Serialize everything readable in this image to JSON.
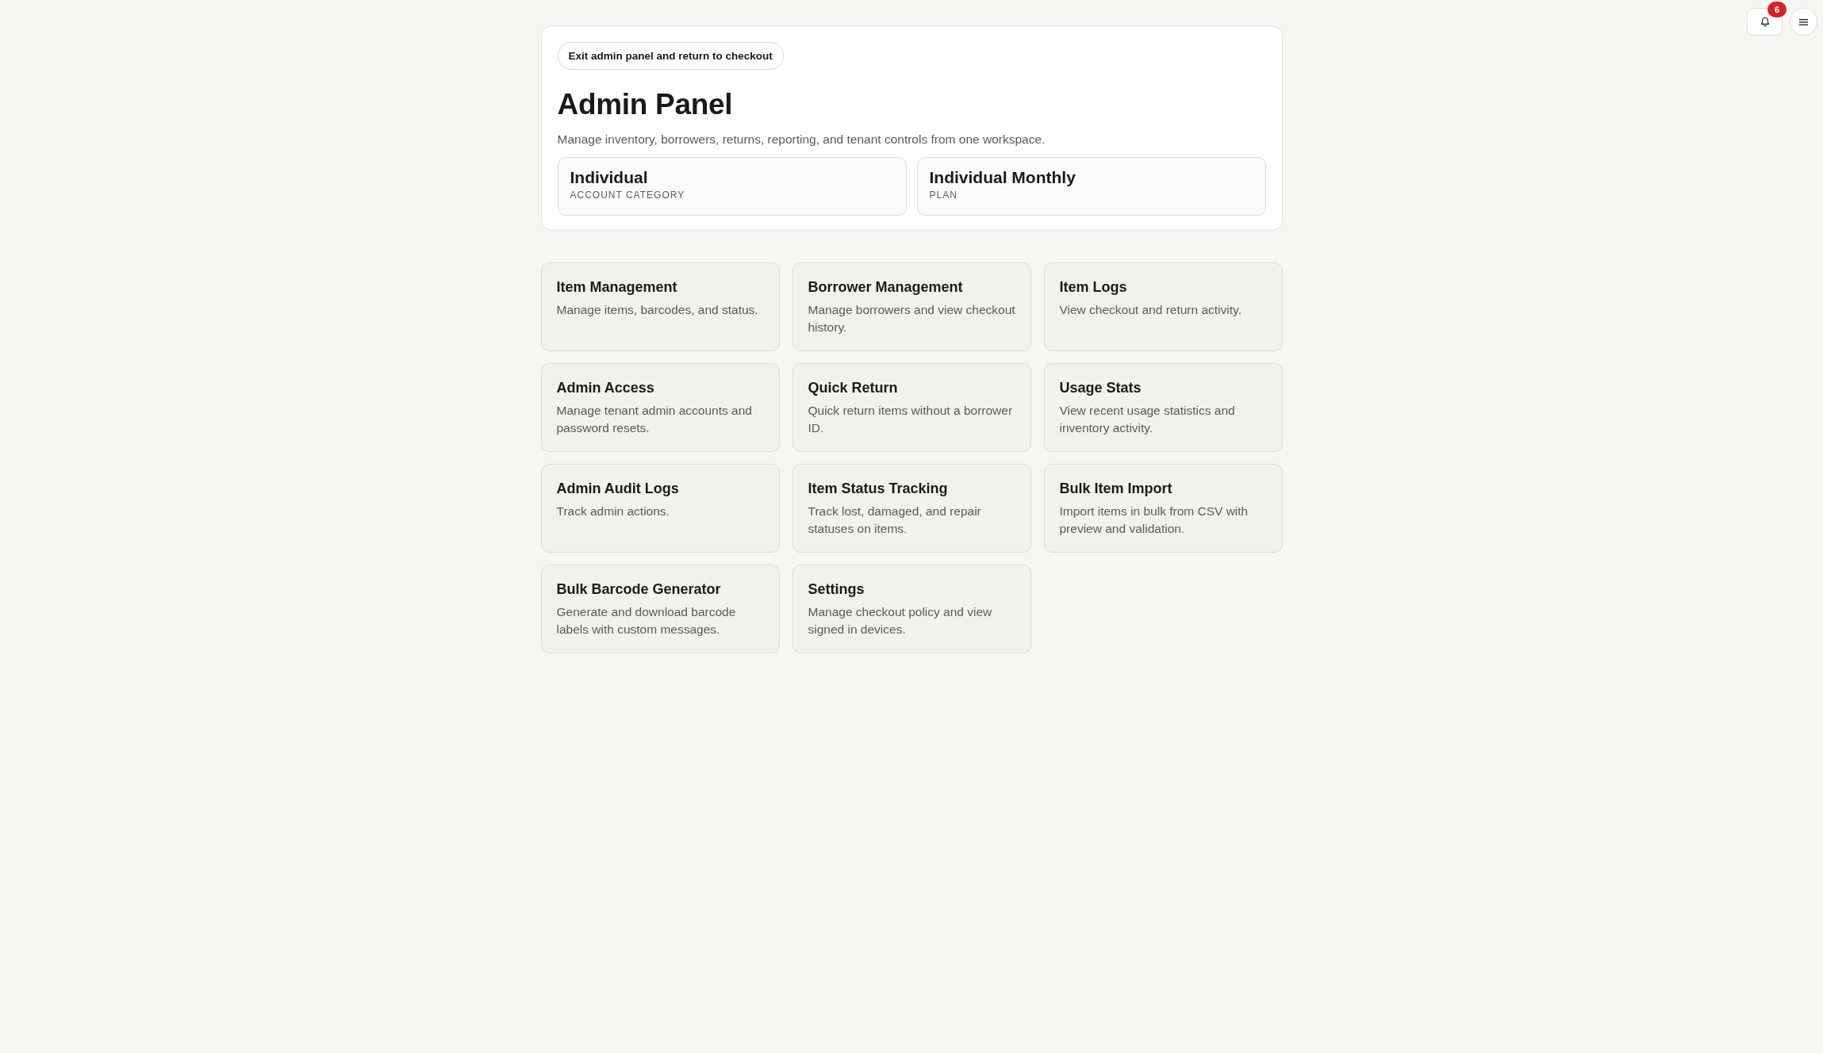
{
  "top_bar": {
    "notification_count": "6"
  },
  "header": {
    "exit_button": "Exit admin panel and return to checkout",
    "title": "Admin Panel",
    "subtitle": "Manage inventory, borrowers, returns, reporting, and tenant controls from one workspace.",
    "info": [
      {
        "value": "Individual",
        "label": "ACCOUNT CATEGORY"
      },
      {
        "value": "Individual Monthly",
        "label": "PLAN"
      }
    ]
  },
  "tools": [
    {
      "title": "Item Management",
      "description": "Manage items, barcodes, and status."
    },
    {
      "title": "Borrower Management",
      "description": "Manage borrowers and view checkout history."
    },
    {
      "title": "Item Logs",
      "description": "View checkout and return activity."
    },
    {
      "title": "Admin Access",
      "description": "Manage tenant admin accounts and password resets."
    },
    {
      "title": "Quick Return",
      "description": "Quick return items without a borrower ID."
    },
    {
      "title": "Usage Stats",
      "description": "View recent usage statistics and inventory activity."
    },
    {
      "title": "Admin Audit Logs",
      "description": "Track admin actions."
    },
    {
      "title": "Item Status Tracking",
      "description": "Track lost, damaged, and repair statuses on items."
    },
    {
      "title": "Bulk Item Import",
      "description": "Import items in bulk from CSV with preview and validation."
    },
    {
      "title": "Bulk Barcode Generator",
      "description": "Generate and download barcode labels with custom messages."
    },
    {
      "title": "Settings",
      "description": "Manage checkout policy and view signed in devices."
    }
  ]
}
